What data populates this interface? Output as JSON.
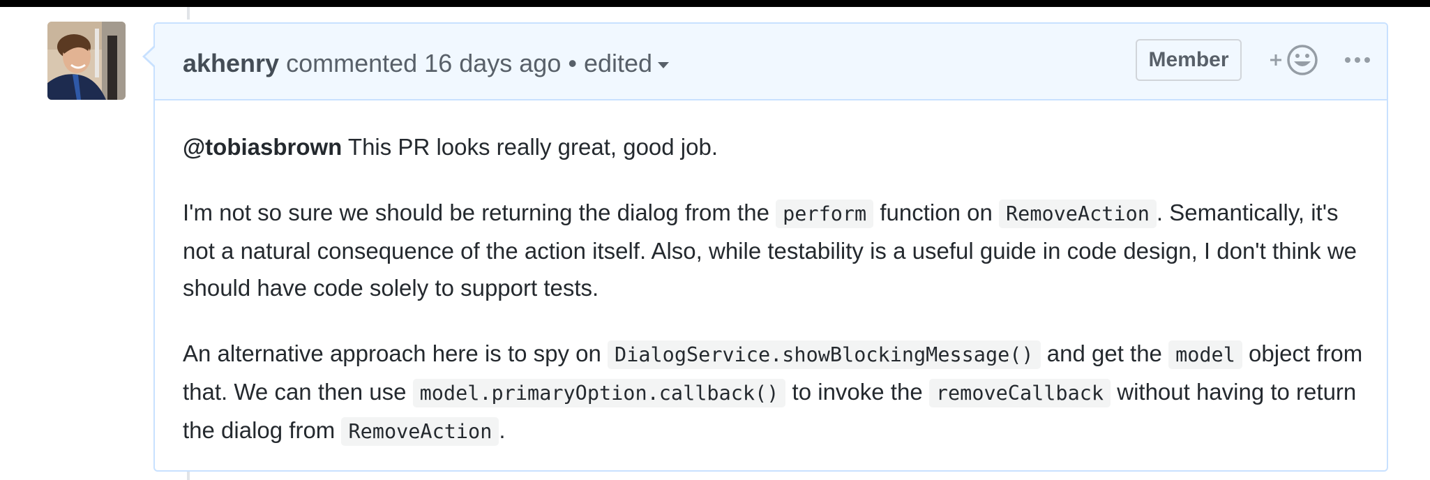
{
  "comment": {
    "author": "akhenry",
    "action": "commented 16 days ago",
    "separator": "•",
    "edited_label": "edited",
    "badge": "Member",
    "avatar_icon": "avatar-photo",
    "reaction_icon": "add-reaction-icon",
    "more_icon": "kebab-horizontal-icon",
    "body": {
      "p1": {
        "mention": "@tobiasbrown",
        "text": " This PR looks really great, good job."
      },
      "p2": {
        "t1": "I'm not so sure we should be returning the dialog from the ",
        "c1": "perform",
        "t2": " function on ",
        "c2": "RemoveAction",
        "t3": ". Semantically, it's not a natural consequence of the action itself. Also, while testability is a useful guide in code design, I don't think we should have code solely to support tests."
      },
      "p3": {
        "t1": "An alternative approach here is to spy on ",
        "c1": "DialogService.showBlockingMessage()",
        "t2": " and get the ",
        "c2": "model",
        "t3": " object from that. We can then use ",
        "c3": "model.primaryOption.callback()",
        "t4": " to invoke the ",
        "c4": "removeCallback",
        "t5": " without having to return the dialog from ",
        "c5": "RemoveAction",
        "t6": "."
      }
    }
  },
  "colors": {
    "header_bg": "#f1f8ff",
    "border": "#c8e1ff",
    "code_bg": "#f3f4f4",
    "text": "#24292e",
    "muted": "#586069"
  }
}
